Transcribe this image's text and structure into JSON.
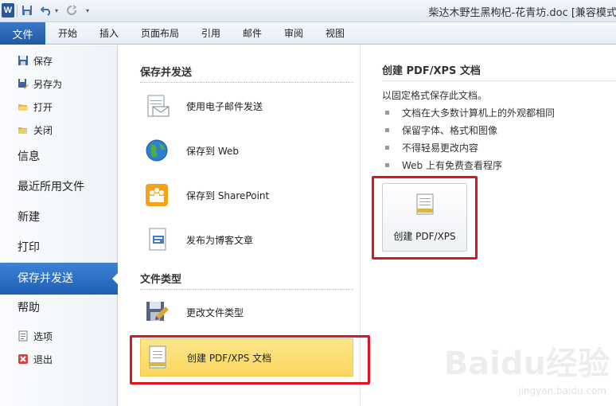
{
  "title_bar": {
    "logo_letter": "W",
    "document_title": "柴达木野生黑枸杞-花青坊.doc [兼容模式]",
    "quick_access": {
      "save_icon": "save-icon",
      "undo_icon": "undo-icon",
      "redo_icon": "redo-icon"
    }
  },
  "ribbon": {
    "file_tab": "文件",
    "tabs": [
      "开始",
      "插入",
      "页面布局",
      "引用",
      "邮件",
      "审阅",
      "视图"
    ]
  },
  "nav": {
    "top_items": [
      {
        "label": "保存",
        "icon": "save-icon"
      },
      {
        "label": "另存为",
        "icon": "save-as-icon"
      },
      {
        "label": "打开",
        "icon": "open-folder-icon"
      },
      {
        "label": "关闭",
        "icon": "close-folder-icon"
      }
    ],
    "main_items": [
      "信息",
      "最近所用文件",
      "新建",
      "打印",
      "保存并发送",
      "帮助"
    ],
    "selected": "保存并发送",
    "bottom_items": [
      {
        "label": "选项",
        "icon": "options-icon"
      },
      {
        "label": "退出",
        "icon": "exit-icon"
      }
    ]
  },
  "middle": {
    "send_heading": "保存并发送",
    "send_items": [
      {
        "label": "使用电子邮件发送",
        "icon": "email-icon"
      },
      {
        "label": "保存到 Web",
        "icon": "globe-icon"
      },
      {
        "label": "保存到 SharePoint",
        "icon": "sharepoint-icon"
      },
      {
        "label": "发布为博客文章",
        "icon": "blog-icon"
      }
    ],
    "filetype_heading": "文件类型",
    "filetype_items": [
      {
        "label": "更改文件类型",
        "icon": "change-type-icon"
      },
      {
        "label": "创建 PDF/XPS 文档",
        "icon": "pdf-doc-icon"
      }
    ]
  },
  "right": {
    "title": "创建 PDF/XPS 文档",
    "description": "以固定格式保存此文档。",
    "bullets": [
      "文档在大多数计算机上的外观都相同",
      "保留字体、格式和图像",
      "不得轻易更改内容",
      "Web 上有免费查看程序"
    ],
    "button_label": "创建 PDF/XPS"
  },
  "watermark": {
    "brand": "Baidu经验",
    "url": "jingyan.baidu.com"
  },
  "colors": {
    "file_tab": "#2a66b5",
    "selected_nav": "#2b6cc4",
    "highlight_item": "#fcdd72",
    "red_box": "#e0141e"
  }
}
